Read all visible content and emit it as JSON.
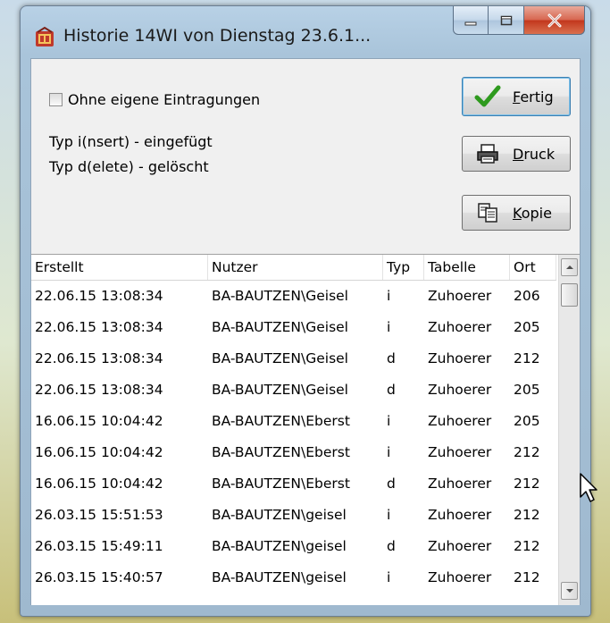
{
  "window": {
    "title": "Historie 14WI von Dienstag 23.6.1...",
    "controls": {
      "minimize": "minimize",
      "maximize": "maximize",
      "close": "close"
    }
  },
  "options": {
    "ohne_eigene_label": "Ohne eigene Eintragungen",
    "ohne_eigene_checked": false
  },
  "info": {
    "line1": "Typ i(nsert) - eingefügt",
    "line2": "Typ d(elete) - gelöscht"
  },
  "buttons": {
    "fertig": {
      "hotkey": "F",
      "rest": "ertig",
      "icon": "checkmark-icon"
    },
    "druck": {
      "hotkey": "D",
      "rest": "ruck",
      "icon": "printer-icon"
    },
    "kopie": {
      "hotkey": "K",
      "rest": "opie",
      "icon": "copy-icon"
    }
  },
  "table": {
    "columns": [
      "Erstellt",
      "Nutzer",
      "Typ",
      "Tabelle",
      "Ort"
    ],
    "rows": [
      [
        "22.06.15 13:08:34",
        "BA-BAUTZEN\\Geisel",
        "i",
        "Zuhoerer",
        "206"
      ],
      [
        "22.06.15 13:08:34",
        "BA-BAUTZEN\\Geisel",
        "i",
        "Zuhoerer",
        "205"
      ],
      [
        "22.06.15 13:08:34",
        "BA-BAUTZEN\\Geisel",
        "d",
        "Zuhoerer",
        "212"
      ],
      [
        "22.06.15 13:08:34",
        "BA-BAUTZEN\\Geisel",
        "d",
        "Zuhoerer",
        "205"
      ],
      [
        "16.06.15 10:04:42",
        "BA-BAUTZEN\\Eberst",
        "i",
        "Zuhoerer",
        "205"
      ],
      [
        "16.06.15 10:04:42",
        "BA-BAUTZEN\\Eberst",
        "i",
        "Zuhoerer",
        "212"
      ],
      [
        "16.06.15 10:04:42",
        "BA-BAUTZEN\\Eberst",
        "d",
        "Zuhoerer",
        "212"
      ],
      [
        "26.03.15 15:51:53",
        "BA-BAUTZEN\\geisel",
        "i",
        "Zuhoerer",
        "212"
      ],
      [
        "26.03.15 15:49:11",
        "BA-BAUTZEN\\geisel",
        "d",
        "Zuhoerer",
        "212"
      ],
      [
        "26.03.15 15:40:57",
        "BA-BAUTZEN\\geisel",
        "i",
        "Zuhoerer",
        "212"
      ]
    ]
  },
  "colors": {
    "check_green": "#2e9a1e",
    "close_red": "#c2361c",
    "title_bar": "#b8d1e6"
  }
}
